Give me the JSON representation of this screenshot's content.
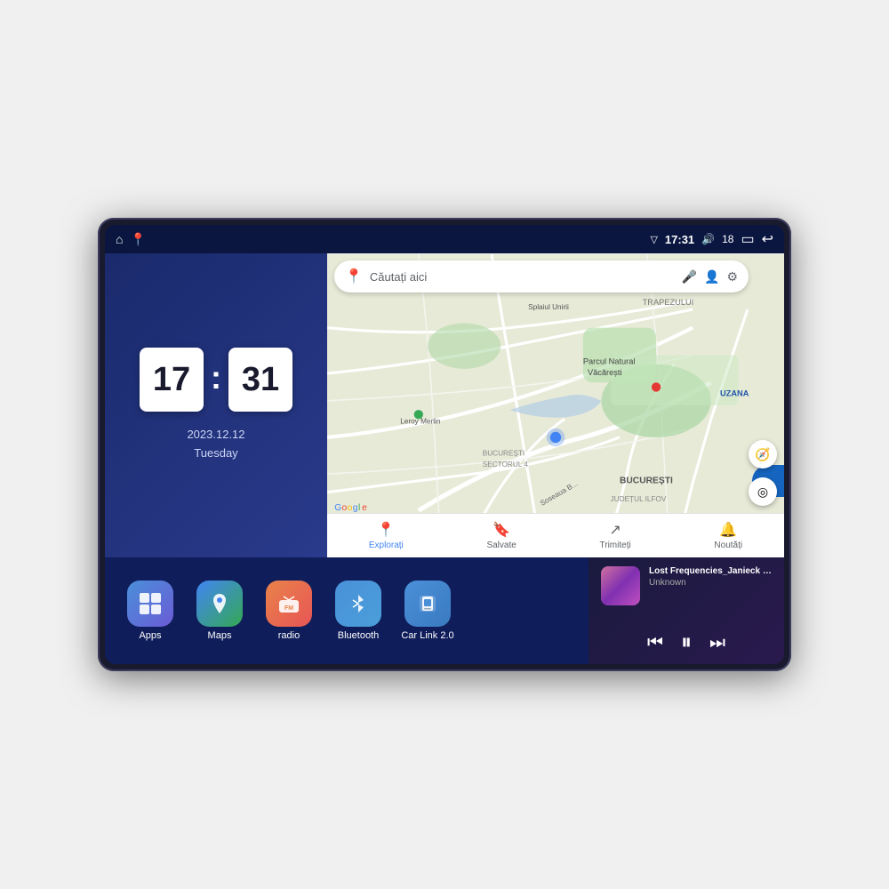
{
  "device": {
    "status_bar": {
      "signal_icon": "▽",
      "time": "17:31",
      "volume_icon": "🔊",
      "volume_level": "18",
      "battery_icon": "▭",
      "back_icon": "↩",
      "home_icon": "⌂",
      "maps_icon": "📍"
    },
    "clock": {
      "hour": "17",
      "minute": "31",
      "date": "2023.12.12",
      "day": "Tuesday"
    },
    "map": {
      "search_placeholder": "Căutați aici",
      "nav_items": [
        {
          "label": "Explorați",
          "icon": "📍",
          "active": true
        },
        {
          "label": "Salvate",
          "icon": "🔖",
          "active": false
        },
        {
          "label": "Trimiteți",
          "icon": "↗",
          "active": false
        },
        {
          "label": "Noutăți",
          "icon": "🔔",
          "active": false
        }
      ]
    },
    "apps": [
      {
        "label": "Apps",
        "icon_class": "app-icon-apps",
        "icon": "⊞"
      },
      {
        "label": "Maps",
        "icon_class": "app-icon-maps",
        "icon": "🗺"
      },
      {
        "label": "radio",
        "icon_class": "app-icon-radio",
        "icon": "📻"
      },
      {
        "label": "Bluetooth",
        "icon_class": "app-icon-bluetooth",
        "icon": "🔵"
      },
      {
        "label": "Car Link 2.0",
        "icon_class": "app-icon-carlink",
        "icon": "📱"
      }
    ],
    "music": {
      "title": "Lost Frequencies_Janieck Devy-...",
      "artist": "Unknown",
      "prev_label": "⏮",
      "play_label": "⏸",
      "next_label": "⏭"
    }
  }
}
